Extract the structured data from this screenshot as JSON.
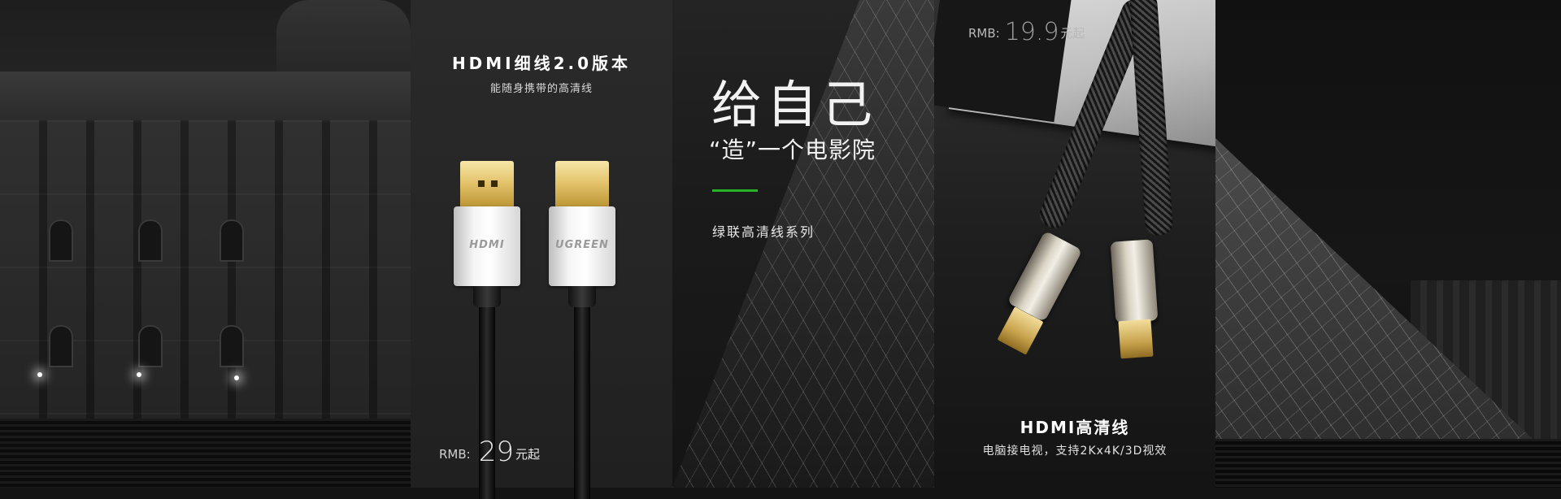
{
  "panel_thin": {
    "title": "HDMI细线2.0版本",
    "subtitle": "能随身携带的高清线",
    "price_label": "RMB:",
    "price_value": "29",
    "price_unit": "元起",
    "connector_left_label": "HDMI",
    "connector_right_label": "UGREEN"
  },
  "center": {
    "headline": "给自己",
    "tagline": "“造”一个电影院",
    "series": "绿联高清线系列",
    "accent_color": "#27b227"
  },
  "panel_braided": {
    "price_label": "RMB:",
    "price_value": "19.9",
    "price_unit": "元起",
    "title": "HDMI高清线",
    "subtitle": "电脑接电视，支持2Kx4K/3D视效"
  },
  "icons": [
    "hdmi-connector-icon",
    "braided-hdmi-cable-icon"
  ]
}
